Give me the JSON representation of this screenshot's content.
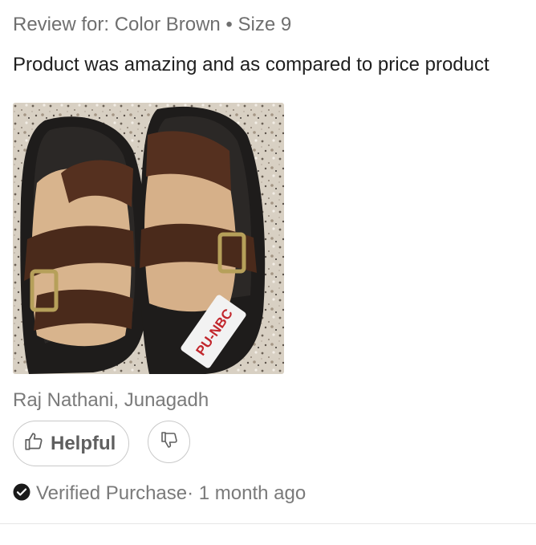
{
  "review": {
    "variant": "Review for: Color Brown • Size 9",
    "text": "Product was amazing and as compared to price product",
    "author": "Raj Nathani, Junagadh",
    "helpful_label": "Helpful",
    "verified_label": "Verified Purchase",
    "time_ago": "· 1 month ago",
    "photo_tag_text": "PU-NBC"
  },
  "icons": {
    "helpful": "thumbs-up-icon",
    "not_helpful": "thumbs-down-icon",
    "verified": "check-circle-icon"
  },
  "colors": {
    "text_secondary": "#7a7a7a",
    "text_primary": "#1f1f1f",
    "border": "#c9c9c9"
  }
}
